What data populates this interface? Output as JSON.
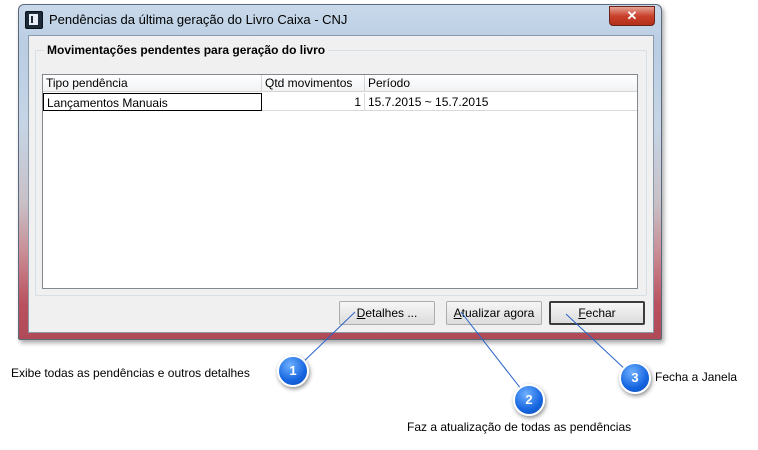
{
  "window": {
    "title": "Pendências da última geração do Livro Caixa - CNJ",
    "close_glyph": "✕"
  },
  "group": {
    "title": "Movimentações pendentes para geração do livro"
  },
  "grid": {
    "columns": [
      "Tipo pendência",
      "Qtd movimentos",
      "Período"
    ],
    "rows": [
      {
        "tipo": "Lançamentos Manuais",
        "qtd": "1",
        "periodo": "15.7.2015 ~ 15.7.2015"
      }
    ]
  },
  "buttons": {
    "details_mnemonic": "D",
    "details_rest": "etalhes ...",
    "update_mnemonic": "A",
    "update_rest": "tualizar agora",
    "close_mnemonic": "F",
    "close_rest": "echar"
  },
  "callouts": [
    {
      "number": "1",
      "text": "Exibe todas as pendências e outros detalhes"
    },
    {
      "number": "2",
      "text": "Faz a atualização de todas as pendências"
    },
    {
      "number": "3",
      "text": "Fecha a Janela"
    }
  ],
  "colors": {
    "callout_blue": "#1565e0",
    "leader_line": "#2a64c8",
    "titlebar_close": "#c9412c"
  }
}
